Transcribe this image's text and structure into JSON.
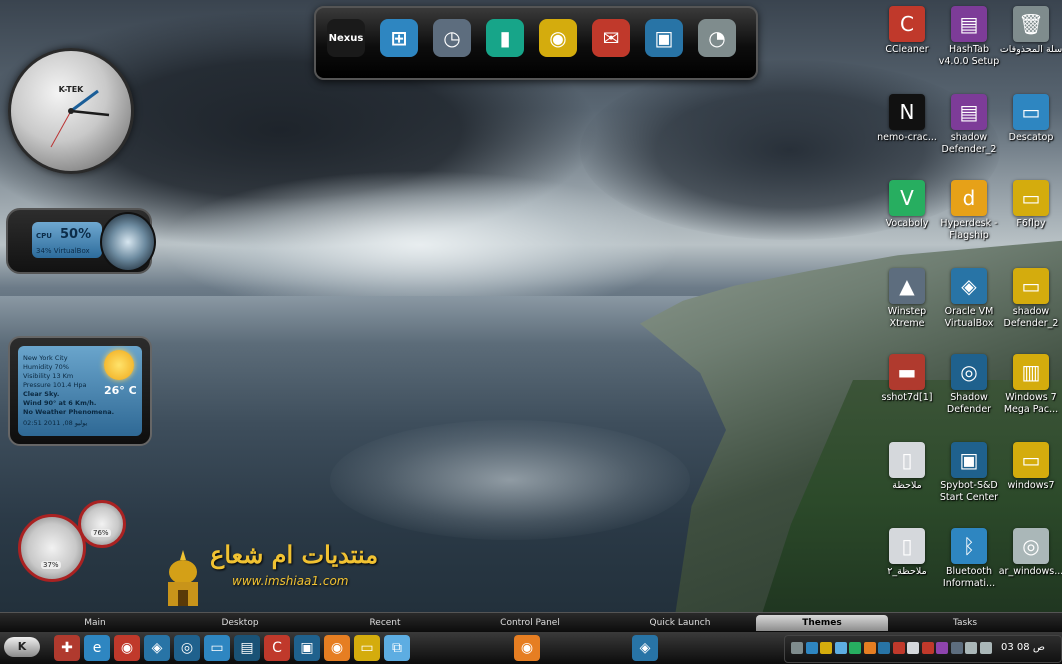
{
  "dock": {
    "items": [
      {
        "name": "nexus-icon",
        "glyph": "Nexus"
      },
      {
        "name": "windows-icon",
        "glyph": "⊞"
      },
      {
        "name": "clock-icon",
        "glyph": "◷"
      },
      {
        "name": "battery-icon",
        "glyph": "▮"
      },
      {
        "name": "globe-icon",
        "glyph": "◉"
      },
      {
        "name": "mail-icon",
        "glyph": "✉"
      },
      {
        "name": "camera-icon",
        "glyph": "▣"
      },
      {
        "name": "scheduler-icon",
        "glyph": "◔"
      }
    ]
  },
  "clock_gadget": {
    "brand": "K-TEK"
  },
  "cpu_gadget": {
    "label": "CPU",
    "value": "50%",
    "ram": "34% VirtualBox"
  },
  "weather_gadget": {
    "city": "New York City",
    "humidity": "Humidity 70%",
    "visibility": "Visibility 13 Km",
    "pressure": "Pressure 101.4 Hpa",
    "sky": "Clear Sky.",
    "wind": "Wind 90° at 6 Km/h.",
    "phenomena": "No Weather Phenomena.",
    "date": "02:51 2011 ,08 يوليو",
    "temperature": "26° C"
  },
  "meters": {
    "gauge1": "37%",
    "gauge2": "76%"
  },
  "logo": {
    "text": "منتديات ام شعاع",
    "url": "www.imshiaa1.com"
  },
  "desktop_icons": [
    {
      "name": "ccleaner",
      "label": "CCleaner",
      "glyph": "C",
      "color": "#c0392b"
    },
    {
      "name": "hashtab",
      "label": "HashTab v4.0.0 Setup",
      "glyph": "▤",
      "color": "#7d3c98"
    },
    {
      "name": "recycle-bin",
      "label": "سلة المحذوفات",
      "glyph": "🗑",
      "color": "#7f8c8d"
    },
    {
      "name": "nemo-crack",
      "label": "nemo-crac...",
      "glyph": "N",
      "color": "#111111"
    },
    {
      "name": "shadow-defender-2a",
      "label": "shadow Defender_2",
      "glyph": "▤",
      "color": "#7d3c98"
    },
    {
      "name": "descatop",
      "label": "Descatop",
      "glyph": "▭",
      "color": "#2e86c1"
    },
    {
      "name": "vocaboly",
      "label": "Vocaboly",
      "glyph": "V",
      "color": "#27ae60"
    },
    {
      "name": "hyperdesk",
      "label": "Hyperdesk - Flagship",
      "glyph": "d",
      "color": "#e6a118"
    },
    {
      "name": "f6flpy",
      "label": "F6flpy",
      "glyph": "▭",
      "color": "#d4ac0d"
    },
    {
      "name": "winstep-xtreme",
      "label": "Winstep Xtreme",
      "glyph": "▲",
      "color": "#5d6d7e"
    },
    {
      "name": "oracle-vm",
      "label": "Oracle VM VirtualBox",
      "glyph": "◈",
      "color": "#2874a6"
    },
    {
      "name": "shadow-defender-2b",
      "label": "shadow Defender_2",
      "glyph": "▭",
      "color": "#d4ac0d"
    },
    {
      "name": "sshot",
      "label": "sshot7d[1]",
      "glyph": "▬",
      "color": "#b03a2e"
    },
    {
      "name": "shadow-defender",
      "label": "Shadow Defender",
      "glyph": "◎",
      "color": "#1f618d"
    },
    {
      "name": "windows7-mega-pack",
      "label": "Windows 7 Mega Pac...",
      "glyph": "▥",
      "color": "#d4ac0d"
    },
    {
      "name": "note-file",
      "label": "ملاحظة",
      "glyph": "▯",
      "color": "#d5d8dc"
    },
    {
      "name": "spybot",
      "label": "Spybot-S&D Start Center",
      "glyph": "▣",
      "color": "#1f618d"
    },
    {
      "name": "windows7-folder",
      "label": "windows7",
      "glyph": "▭",
      "color": "#d4ac0d"
    },
    {
      "name": "note-file-2",
      "label": "ملاحظة_٢",
      "glyph": "▯",
      "color": "#d5d8dc"
    },
    {
      "name": "bluetooth-info",
      "label": "Bluetooth Informati...",
      "glyph": "ᛒ",
      "color": "#2e86c1"
    },
    {
      "name": "ar-windows",
      "label": "ar_windows...",
      "glyph": "◎",
      "color": "#aab7b8"
    }
  ],
  "tabs": [
    "Main",
    "Desktop",
    "Recent",
    "Control Panel",
    "Quick Launch",
    "Themes",
    "Tasks"
  ],
  "active_tab": "Themes",
  "taskbar": {
    "start_label": "K",
    "quick_launch": [
      {
        "name": "app1-icon",
        "glyph": "✚",
        "color": "#b03a2e"
      },
      {
        "name": "ie-icon",
        "glyph": "e",
        "color": "#2e86c1"
      },
      {
        "name": "app3-icon",
        "glyph": "◉",
        "color": "#c0392b"
      },
      {
        "name": "virtualbox-icon",
        "glyph": "◈",
        "color": "#2874a6"
      },
      {
        "name": "shadow-icon",
        "glyph": "◎",
        "color": "#1f618d"
      },
      {
        "name": "desktop-icon",
        "glyph": "▭",
        "color": "#2e86c1"
      },
      {
        "name": "book-icon",
        "glyph": "▤",
        "color": "#1a5276"
      },
      {
        "name": "ccleaner-icon",
        "glyph": "C",
        "color": "#c0392b"
      },
      {
        "name": "monitor-icon",
        "glyph": "▣",
        "color": "#1f618d"
      },
      {
        "name": "firefox-icon",
        "glyph": "◉",
        "color": "#e67e22"
      },
      {
        "name": "folder-icon",
        "glyph": "▭",
        "color": "#d4ac0d"
      },
      {
        "name": "network-icon",
        "glyph": "⧉",
        "color": "#5dade2"
      }
    ],
    "running": [
      {
        "name": "firefox-task-icon",
        "glyph": "◉",
        "color": "#e67e22"
      },
      {
        "name": "virtualbox-task-icon",
        "glyph": "◈",
        "color": "#2874a6"
      }
    ],
    "clock": "03 08 ص"
  }
}
